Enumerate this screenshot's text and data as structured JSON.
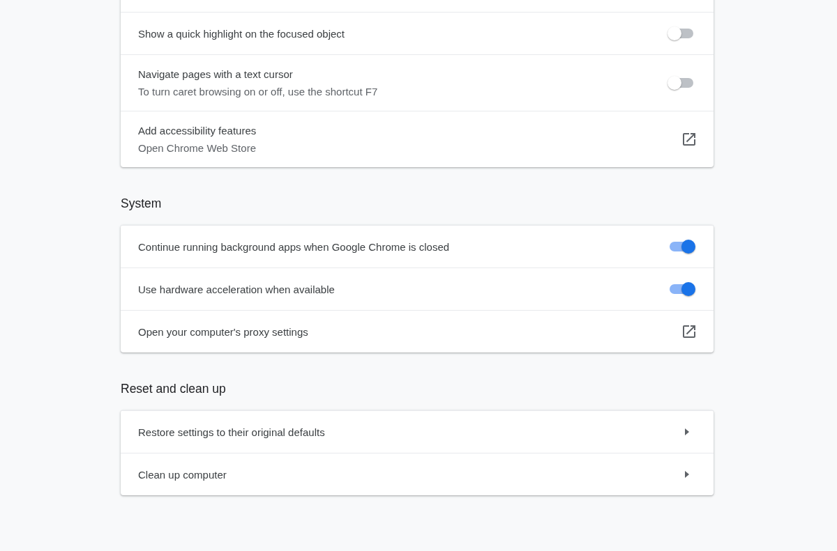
{
  "sections": [
    {
      "rows": [
        {
          "kind": "toggle",
          "label": "Show a quick highlight on the focused object",
          "on": false
        },
        {
          "kind": "toggle",
          "label": "Navigate pages with a text cursor",
          "sublabel": "To turn caret browsing on or off, use the shortcut F7",
          "on": false
        },
        {
          "kind": "external",
          "label": "Add accessibility features",
          "sublabel": "Open Chrome Web Store"
        }
      ]
    },
    {
      "title": "System",
      "rows": [
        {
          "kind": "toggle",
          "label": "Continue running background apps when Google Chrome is closed",
          "on": true
        },
        {
          "kind": "toggle",
          "label": "Use hardware acceleration when available",
          "on": true
        },
        {
          "kind": "external",
          "label": "Open your computer's proxy settings"
        }
      ]
    },
    {
      "title": "Reset and clean up",
      "rows": [
        {
          "kind": "arrow",
          "label": "Restore settings to their original defaults"
        },
        {
          "kind": "arrow",
          "label": "Clean up computer"
        }
      ]
    }
  ]
}
